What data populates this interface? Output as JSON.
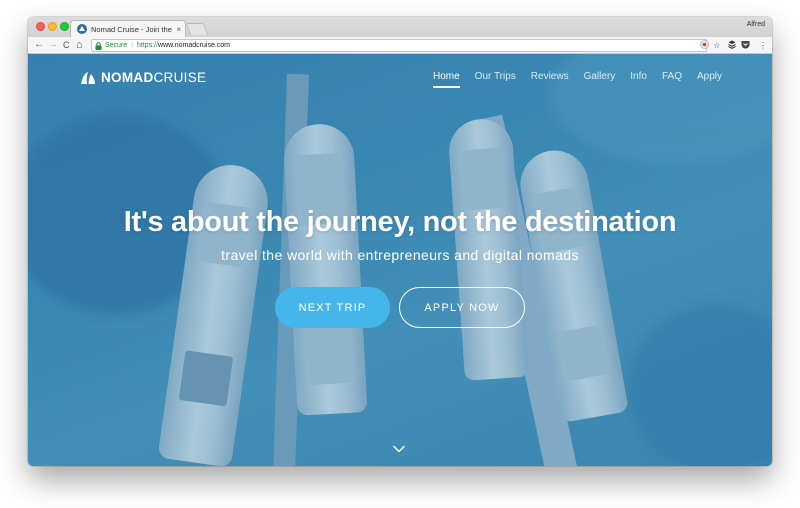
{
  "browser": {
    "tab_title": "Nomad Cruise - Join the Digital",
    "tab_close": "×",
    "profile_name": "Alfred",
    "security_label": "Secure",
    "url_protocol": "https://",
    "url_host": "www.nomadcruise.com",
    "back_glyph": "←",
    "forward_glyph": "→",
    "reload_glyph": "C",
    "home_glyph": "⌂",
    "star_glyph": "☆",
    "menu_glyph": "⋮",
    "icons": [
      "back-icon",
      "forward-icon",
      "reload-icon",
      "home-icon",
      "lock-icon",
      "star-icon",
      "layers-icon",
      "pocket-icon",
      "menu-icon"
    ]
  },
  "site": {
    "logo_bold": "NOMAD",
    "logo_light": "CRUISE",
    "nav": [
      {
        "label": "Home",
        "active": true
      },
      {
        "label": "Our Trips",
        "active": false
      },
      {
        "label": "Reviews",
        "active": false
      },
      {
        "label": "Gallery",
        "active": false
      },
      {
        "label": "Info",
        "active": false
      },
      {
        "label": "FAQ",
        "active": false
      },
      {
        "label": "Apply",
        "active": false
      }
    ],
    "hero": {
      "title": "It's about the journey, not the destination",
      "subtitle": "travel the world with entrepreneurs and digital nomads",
      "primary_button": "NEXT TRIP",
      "secondary_button": "APPLY NOW"
    }
  },
  "colors": {
    "accent": "#45b6ea",
    "hero_water": "#3f8cb6",
    "secure_green": "#1e8e3e"
  }
}
